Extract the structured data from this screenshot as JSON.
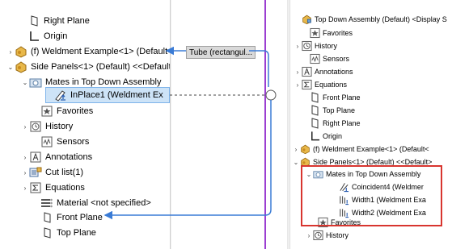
{
  "left_tree": {
    "items": [
      {
        "label": "Right Plane",
        "icon": "plane-icon",
        "exp": ""
      },
      {
        "label": "Origin",
        "icon": "origin-icon",
        "exp": ""
      },
      {
        "label": "(f) Weldment Example<1> (Default<",
        "icon": "part-icon",
        "exp": "›"
      },
      {
        "label": "Side Panels<1> (Default) <<Default>",
        "icon": "part-icon",
        "exp": "⌄"
      },
      {
        "label": "Mates in Top Down Assembly",
        "icon": "mates-folder-icon",
        "exp": "⌄"
      },
      {
        "label": "InPlace1 (Weldment Ex",
        "icon": "inplace-mate-icon",
        "exp": ""
      },
      {
        "label": "Favorites",
        "icon": "favorites-icon",
        "exp": ""
      },
      {
        "label": "History",
        "icon": "history-icon",
        "exp": "›"
      },
      {
        "label": "Sensors",
        "icon": "sensors-icon",
        "exp": ""
      },
      {
        "label": "Annotations",
        "icon": "annotations-icon",
        "exp": "›"
      },
      {
        "label": "Cut list(1)",
        "icon": "cut-list-icon",
        "exp": "›"
      },
      {
        "label": "Equations",
        "icon": "equations-icon",
        "exp": "›"
      },
      {
        "label": "Material <not specified>",
        "icon": "material-icon",
        "exp": ""
      },
      {
        "label": "Front Plane",
        "icon": "plane-icon",
        "exp": ""
      },
      {
        "label": "Top Plane",
        "icon": "plane-icon",
        "exp": ""
      }
    ]
  },
  "tooltip": {
    "label": "Tube (rectangul..."
  },
  "right_tree": {
    "items": [
      {
        "label": "Top Down Assembly (Default) <Display S",
        "icon": "assembly-icon",
        "exp": ""
      },
      {
        "label": "Favorites",
        "icon": "favorites-icon",
        "exp": ""
      },
      {
        "label": "History",
        "icon": "history-icon",
        "exp": "›"
      },
      {
        "label": "Sensors",
        "icon": "sensors-icon",
        "exp": ""
      },
      {
        "label": "Annotations",
        "icon": "annotations-icon",
        "exp": "›"
      },
      {
        "label": "Equations",
        "icon": "equations-icon",
        "exp": "›"
      },
      {
        "label": "Front Plane",
        "icon": "plane-icon",
        "exp": ""
      },
      {
        "label": "Top Plane",
        "icon": "plane-icon",
        "exp": ""
      },
      {
        "label": "Right Plane",
        "icon": "plane-icon",
        "exp": ""
      },
      {
        "label": "Origin",
        "icon": "origin-icon",
        "exp": ""
      },
      {
        "label": "(f) Weldment Example<1> (Default<",
        "icon": "part-icon",
        "exp": "›"
      },
      {
        "label": "Side Panels<1> (Default) <<Default>",
        "icon": "part-icon",
        "exp": "⌄"
      },
      {
        "label": "Mates in Top Down Assembly",
        "icon": "mates-folder-icon",
        "exp": "⌄"
      },
      {
        "label": "Coincident4 (Weldmer",
        "icon": "coincident-mate-icon",
        "exp": ""
      },
      {
        "label": "Width1 (Weldment Exa",
        "icon": "width-mate-icon",
        "exp": ""
      },
      {
        "label": "Width2 (Weldment Exa",
        "icon": "width-mate-icon",
        "exp": ""
      },
      {
        "label": "Favorites",
        "icon": "favorites-icon",
        "exp": ""
      },
      {
        "label": "History",
        "icon": "history-icon",
        "exp": "›"
      }
    ]
  },
  "colors": {
    "selection": "#cde3f7",
    "highlight_box": "#d8352f",
    "arrow": "#3a7bd5",
    "purple_line": "#9b3fd1"
  }
}
